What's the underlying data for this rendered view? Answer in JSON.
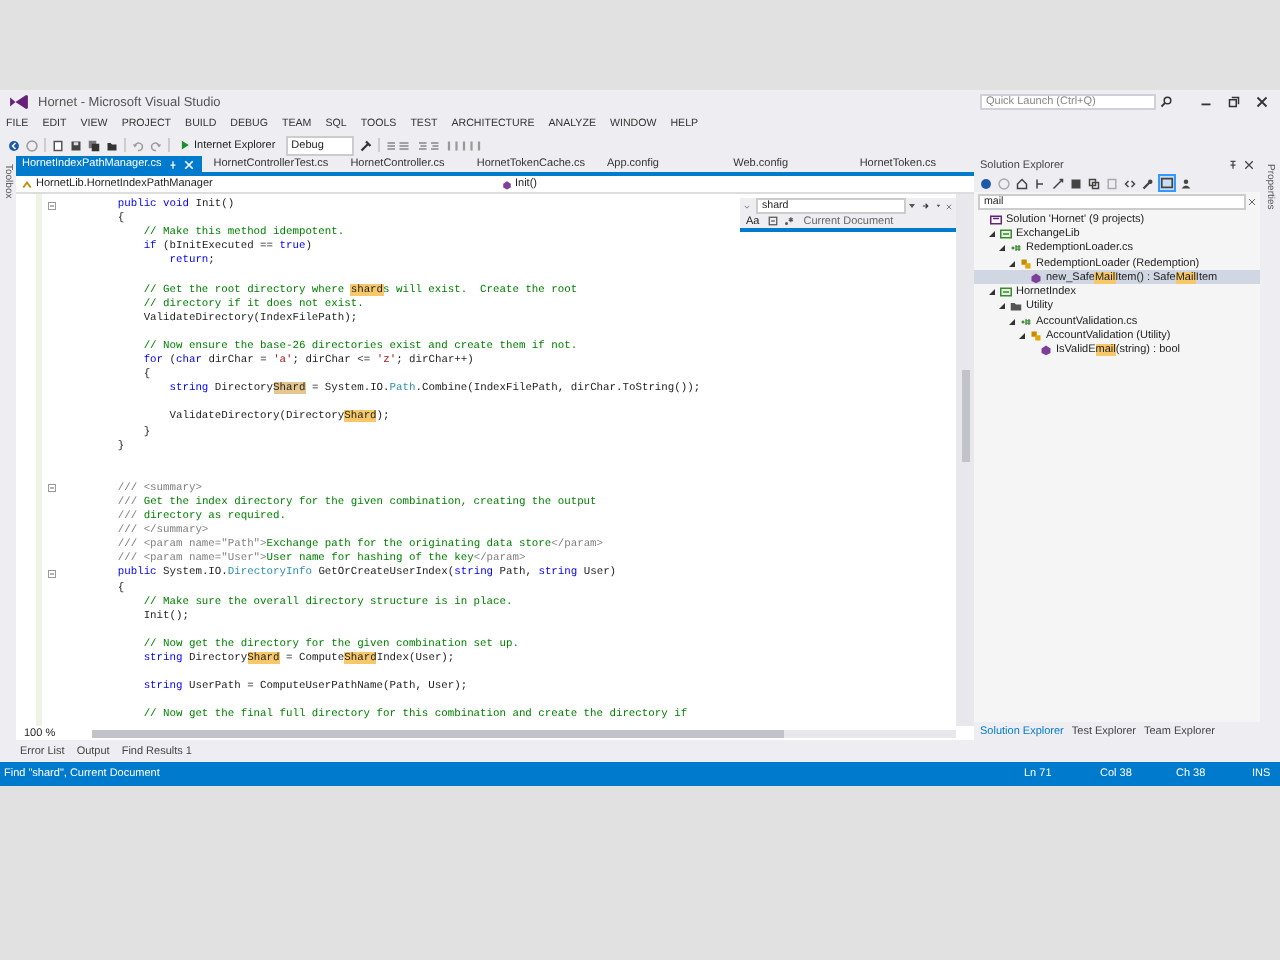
{
  "window": {
    "title": "Hornet - Microsoft Visual Studio",
    "quick_launch": {
      "placeholder": "Quick Launch (Ctrl+Q)"
    }
  },
  "menu": [
    "FILE",
    "EDIT",
    "VIEW",
    "PROJECT",
    "BUILD",
    "DEBUG",
    "TEAM",
    "SQL",
    "TOOLS",
    "TEST",
    "ARCHITECTURE",
    "ANALYZE",
    "WINDOW",
    "HELP"
  ],
  "toolbar": {
    "run_target": "Internet Explorer",
    "configuration": "Debug"
  },
  "side_tabs": {
    "left": "Toolbox",
    "right": "Properties"
  },
  "editor": {
    "tabs": [
      {
        "label": "HornetIndexPathManager.cs",
        "selected": true
      },
      {
        "label": "HornetControllerTest.cs",
        "selected": false
      },
      {
        "label": "HornetController.cs",
        "selected": false
      },
      {
        "label": "HornetTokenCache.cs",
        "selected": false
      },
      {
        "label": "App.config",
        "selected": false
      },
      {
        "label": "Web.config",
        "selected": false
      },
      {
        "label": "HornetToken.cs",
        "selected": false
      }
    ],
    "nav": {
      "type_path": "HornetLib.HornetIndexPathManager",
      "member": "Init()"
    },
    "find": {
      "value": "shard",
      "match_case": "Aa",
      "scope": "Current Document"
    },
    "lines": [
      {
        "kind": "code",
        "collapsible": true,
        "segments": [
          {
            "kind": "keyword",
            "text": "        public void"
          },
          {
            "kind": "plain",
            "text": " Init()"
          }
        ]
      },
      {
        "kind": "code",
        "segments": [
          {
            "kind": "plain",
            "text": "        {"
          }
        ]
      },
      {
        "kind": "code",
        "segments": [
          {
            "kind": "comment",
            "text": "            // Make this method idempotent."
          }
        ]
      },
      {
        "kind": "code",
        "segments": [
          {
            "kind": "keyword",
            "text": "            if"
          },
          {
            "kind": "plain",
            "text": " (bInitExecuted == "
          },
          {
            "kind": "keyword",
            "text": "true"
          },
          {
            "kind": "plain",
            "text": ")"
          }
        ]
      },
      {
        "kind": "code",
        "segments": [
          {
            "kind": "keyword",
            "text": "                return"
          },
          {
            "kind": "plain",
            "text": ";"
          }
        ]
      },
      {
        "kind": "blank"
      },
      {
        "kind": "code",
        "segments": [
          {
            "kind": "comment",
            "text": "            // Get the root directory where "
          },
          {
            "kind": "match",
            "text": "shard"
          },
          {
            "kind": "comment",
            "text": "s will exist.  Create the root"
          }
        ]
      },
      {
        "kind": "code",
        "segments": [
          {
            "kind": "comment",
            "text": "            // directory if it does not exist."
          }
        ]
      },
      {
        "kind": "code",
        "segments": [
          {
            "kind": "plain",
            "text": "            ValidateDirectory(IndexFilePath);"
          }
        ]
      },
      {
        "kind": "blank"
      },
      {
        "kind": "code",
        "segments": [
          {
            "kind": "comment",
            "text": "            // Now ensure the base-26 directories exist and create them if not."
          }
        ]
      },
      {
        "kind": "code",
        "segments": [
          {
            "kind": "keyword",
            "text": "            for"
          },
          {
            "kind": "plain",
            "text": " ("
          },
          {
            "kind": "keyword",
            "text": "char"
          },
          {
            "kind": "plain",
            "text": " dirChar = "
          },
          {
            "kind": "string",
            "text": "'a'"
          },
          {
            "kind": "plain",
            "text": "; dirChar <= "
          },
          {
            "kind": "string",
            "text": "'z'"
          },
          {
            "kind": "plain",
            "text": "; dirChar++)"
          }
        ]
      },
      {
        "kind": "code",
        "segments": [
          {
            "kind": "plain",
            "text": "            {"
          }
        ]
      },
      {
        "kind": "code",
        "segments": [
          {
            "kind": "keyword",
            "text": "                string"
          },
          {
            "kind": "plain",
            "text": " Directory"
          },
          {
            "kind": "current_match",
            "text": "Shard"
          },
          {
            "kind": "plain",
            "text": " = System.IO."
          },
          {
            "kind": "type",
            "text": "Path"
          },
          {
            "kind": "plain",
            "text": ".Combine(IndexFilePath, dirChar.ToString());"
          }
        ]
      },
      {
        "kind": "blank"
      },
      {
        "kind": "code",
        "segments": [
          {
            "kind": "plain",
            "text": "                ValidateDirectory(Directory"
          },
          {
            "kind": "match",
            "text": "Shard"
          },
          {
            "kind": "plain",
            "text": ");"
          }
        ]
      },
      {
        "kind": "code",
        "segments": [
          {
            "kind": "plain",
            "text": "            }"
          }
        ]
      },
      {
        "kind": "code",
        "segments": [
          {
            "kind": "plain",
            "text": "        }"
          }
        ]
      },
      {
        "kind": "blank"
      },
      {
        "kind": "blank"
      },
      {
        "kind": "code",
        "collapsible": true,
        "segments": [
          {
            "kind": "doc",
            "text": "        /// <summary>"
          }
        ]
      },
      {
        "kind": "code",
        "segments": [
          {
            "kind": "doc",
            "text": "        ///"
          },
          {
            "kind": "comment",
            "text": " Get the index directory for the given combination, creating the output"
          }
        ]
      },
      {
        "kind": "code",
        "segments": [
          {
            "kind": "doc",
            "text": "        ///"
          },
          {
            "kind": "comment",
            "text": " directory as required."
          }
        ]
      },
      {
        "kind": "code",
        "segments": [
          {
            "kind": "doc",
            "text": "        /// </summary>"
          }
        ]
      },
      {
        "kind": "code",
        "segments": [
          {
            "kind": "doc",
            "text": "        /// <param name=\"Path\">"
          },
          {
            "kind": "comment",
            "text": "Exchange path for the originating data store"
          },
          {
            "kind": "doc",
            "text": "</param>"
          }
        ]
      },
      {
        "kind": "code",
        "segments": [
          {
            "kind": "doc",
            "text": "        /// <param name=\"User\">"
          },
          {
            "kind": "comment",
            "text": "User name for hashing of the key"
          },
          {
            "kind": "doc",
            "text": "</param>"
          }
        ]
      },
      {
        "kind": "code",
        "collapsible": true,
        "segments": [
          {
            "kind": "keyword",
            "text": "        public"
          },
          {
            "kind": "plain",
            "text": " System.IO."
          },
          {
            "kind": "type",
            "text": "DirectoryInfo"
          },
          {
            "kind": "plain",
            "text": " GetOrCreateUserIndex("
          },
          {
            "kind": "keyword",
            "text": "string"
          },
          {
            "kind": "plain",
            "text": " Path, "
          },
          {
            "kind": "keyword",
            "text": "string"
          },
          {
            "kind": "plain",
            "text": " User)"
          }
        ]
      },
      {
        "kind": "code",
        "segments": [
          {
            "kind": "plain",
            "text": "        {"
          }
        ]
      },
      {
        "kind": "code",
        "segments": [
          {
            "kind": "comment",
            "text": "            // Make sure the overall directory structure is in place."
          }
        ]
      },
      {
        "kind": "code",
        "segments": [
          {
            "kind": "plain",
            "text": "            Init();"
          }
        ]
      },
      {
        "kind": "blank"
      },
      {
        "kind": "code",
        "segments": [
          {
            "kind": "comment",
            "text": "            // Now get the directory for the given combination set up."
          }
        ]
      },
      {
        "kind": "code",
        "segments": [
          {
            "kind": "keyword",
            "text": "            string"
          },
          {
            "kind": "plain",
            "text": " Directory"
          },
          {
            "kind": "match",
            "text": "Shard"
          },
          {
            "kind": "plain",
            "text": " = Compute"
          },
          {
            "kind": "match",
            "text": "Shard"
          },
          {
            "kind": "plain",
            "text": "Index(User);"
          }
        ]
      },
      {
        "kind": "blank"
      },
      {
        "kind": "code",
        "segments": [
          {
            "kind": "keyword",
            "text": "            string"
          },
          {
            "kind": "plain",
            "text": " UserPath = ComputeUserPathName(Path, User);"
          }
        ]
      },
      {
        "kind": "blank"
      },
      {
        "kind": "code",
        "segments": [
          {
            "kind": "comment",
            "text": "            // Now get the final full directory for this combination and create the directory if"
          }
        ]
      }
    ],
    "zoom": "100 %"
  },
  "solution_explorer": {
    "title": "Solution Explorer",
    "search": {
      "value": "mail"
    },
    "tree": [
      {
        "kind": "solution",
        "label_parts": [
          {
            "kind": "plain",
            "text": "Solution 'Hornet' (9 projects)"
          }
        ],
        "selected": false,
        "children": [
          {
            "kind": "project",
            "expanded": true,
            "label_parts": [
              {
                "kind": "plain",
                "text": "ExchangeLib"
              }
            ],
            "selected": false,
            "children": [
              {
                "kind": "csfile",
                "expanded": true,
                "label_parts": [
                  {
                    "kind": "plain",
                    "text": "RedemptionLoader.cs"
                  }
                ],
                "selected": false,
                "children": [
                  {
                    "kind": "class",
                    "expanded": true,
                    "label_parts": [
                      {
                        "kind": "plain",
                        "text": "RedemptionLoader (Redemption)"
                      }
                    ],
                    "selected": false,
                    "children": [
                      {
                        "kind": "method",
                        "label_parts": [
                          {
                            "kind": "plain",
                            "text": "new_Safe"
                          },
                          {
                            "kind": "match",
                            "text": "Mail"
                          },
                          {
                            "kind": "plain",
                            "text": "Item() : Safe"
                          },
                          {
                            "kind": "match",
                            "text": "Mail"
                          },
                          {
                            "kind": "plain",
                            "text": "Item"
                          }
                        ],
                        "selected": true
                      }
                    ]
                  }
                ]
              }
            ]
          },
          {
            "kind": "project",
            "expanded": true,
            "label_parts": [
              {
                "kind": "plain",
                "text": "HornetIndex"
              }
            ],
            "selected": false,
            "children": [
              {
                "kind": "folder",
                "expanded": true,
                "label_parts": [
                  {
                    "kind": "plain",
                    "text": "Utility"
                  }
                ],
                "selected": false,
                "children": [
                  {
                    "kind": "csfile",
                    "expanded": true,
                    "label_parts": [
                      {
                        "kind": "plain",
                        "text": "AccountValidation.cs"
                      }
                    ],
                    "selected": false,
                    "children": [
                      {
                        "kind": "class",
                        "expanded": true,
                        "label_parts": [
                          {
                            "kind": "plain",
                            "text": "AccountValidation (Utility)"
                          }
                        ],
                        "selected": false,
                        "children": [
                          {
                            "kind": "method",
                            "label_parts": [
                              {
                                "kind": "plain",
                                "text": "IsValidE"
                              },
                              {
                                "kind": "match",
                                "text": "mail"
                              },
                              {
                                "kind": "plain",
                                "text": "(string) : bool"
                              }
                            ],
                            "selected": false
                          }
                        ]
                      }
                    ]
                  }
                ]
              }
            ]
          }
        ]
      }
    ],
    "tabs": [
      {
        "label": "Solution Explorer",
        "selected": true
      },
      {
        "label": "Test Explorer",
        "selected": false
      },
      {
        "label": "Team Explorer",
        "selected": false
      }
    ]
  },
  "output_tabs": [
    {
      "label": "Error List",
      "selected": false
    },
    {
      "label": "Output",
      "selected": false
    },
    {
      "label": "Find Results 1",
      "selected": false
    }
  ],
  "status_bar": {
    "message": "Find \"shard\", Current Document",
    "line": "Ln 71",
    "column": "Col 38",
    "char": "Ch 38",
    "mode": "INS"
  }
}
